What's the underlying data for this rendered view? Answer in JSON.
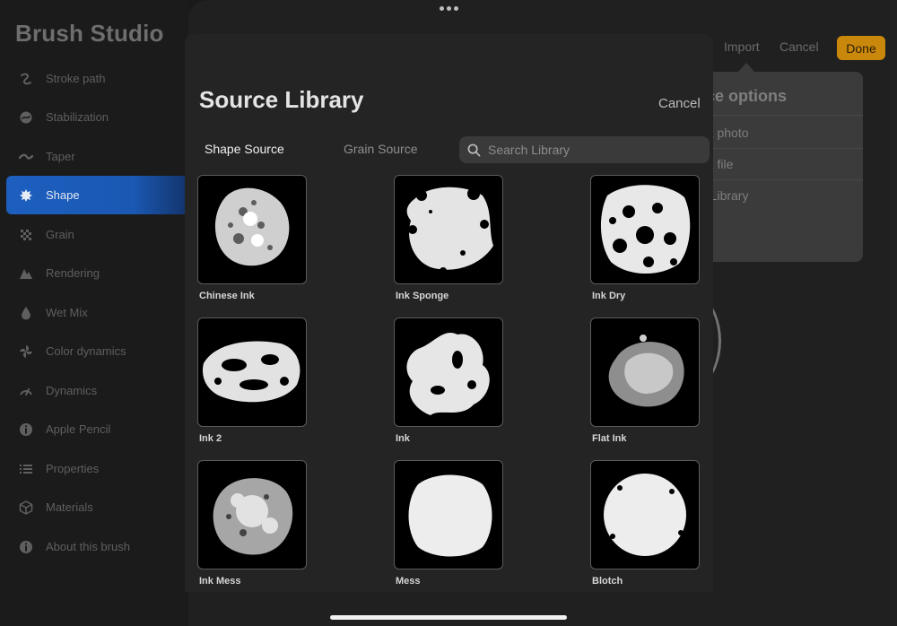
{
  "app": {
    "title": "Brush Studio"
  },
  "sidebar": {
    "items": [
      {
        "label": "Stroke path",
        "icon": "stroke-path-icon",
        "active": false
      },
      {
        "label": "Stabilization",
        "icon": "stabilization-icon",
        "active": false
      },
      {
        "label": "Taper",
        "icon": "taper-icon",
        "active": false
      },
      {
        "label": "Shape",
        "icon": "shape-icon",
        "active": true
      },
      {
        "label": "Grain",
        "icon": "grain-icon",
        "active": false
      },
      {
        "label": "Rendering",
        "icon": "rendering-icon",
        "active": false
      },
      {
        "label": "Wet Mix",
        "icon": "wet-mix-icon",
        "active": false
      },
      {
        "label": "Color dynamics",
        "icon": "color-dynamics-icon",
        "active": false
      },
      {
        "label": "Dynamics",
        "icon": "dynamics-icon",
        "active": false
      },
      {
        "label": "Apple Pencil",
        "icon": "info-icon",
        "active": false
      },
      {
        "label": "Properties",
        "icon": "list-icon",
        "active": false
      },
      {
        "label": "Materials",
        "icon": "cube-icon",
        "active": false
      },
      {
        "label": "About this brush",
        "icon": "info-icon",
        "active": false
      }
    ]
  },
  "toolbar": {
    "import_label": "Import",
    "cancel_label": "Cancel",
    "done_label": "Done"
  },
  "popover": {
    "title": "rce options",
    "items": [
      "t a photo",
      "t a file",
      "e Library"
    ]
  },
  "modal": {
    "title": "Source Library",
    "cancel_label": "Cancel",
    "tabs": [
      {
        "label": "Shape Source",
        "active": true
      },
      {
        "label": "Grain Source",
        "active": false
      }
    ],
    "search": {
      "placeholder": "Search Library",
      "value": ""
    },
    "items": [
      {
        "label": "Chinese Ink",
        "shape": "speckled-blob"
      },
      {
        "label": "Ink Sponge",
        "shape": "sponge-blob"
      },
      {
        "label": "Ink Dry",
        "shape": "holey-blob"
      },
      {
        "label": "Ink 2",
        "shape": "wide-holey-blob"
      },
      {
        "label": "Ink",
        "shape": "splat-blob"
      },
      {
        "label": "Flat Ink",
        "shape": "faint-blob"
      },
      {
        "label": "Ink Mess",
        "shape": "messy-blob"
      },
      {
        "label": "Mess",
        "shape": "solid-blob"
      },
      {
        "label": "Blotch",
        "shape": "round-blob"
      }
    ]
  },
  "colors": {
    "accent": "#1a58b3",
    "done": "#c9870c",
    "modal_bg": "#242424"
  }
}
